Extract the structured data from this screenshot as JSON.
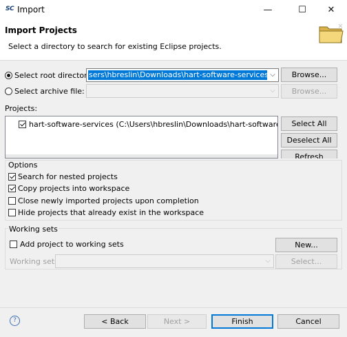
{
  "window": {
    "app_icon": "SC",
    "title": "Import",
    "controls": [
      "—",
      "☐",
      "✕"
    ]
  },
  "banner": {
    "title": "Import Projects",
    "description": "Select a directory to search for existing Eclipse projects."
  },
  "source": {
    "root_directory_label": "Select root directory:",
    "root_directory_value": "sers\\hbreslin\\Downloads\\hart-software-services-master",
    "root_selected": true,
    "archive_file_label": "Select archive file:",
    "archive_file_value": "",
    "browse_label": "Browse...",
    "browse_archive_label": "Browse..."
  },
  "projects": {
    "label": "Projects:",
    "items": [
      {
        "checked": true,
        "text": "hart-software-services (C:\\Users\\hbreslin\\Downloads\\hart-software-services-m"
      }
    ],
    "select_all_label": "Select All",
    "deselect_all_label": "Deselect All",
    "refresh_label": "Refresh"
  },
  "options": {
    "label": "Options",
    "items": [
      {
        "label": "Search for nested projects",
        "checked": true
      },
      {
        "label": "Copy projects into workspace",
        "checked": true
      },
      {
        "label": "Close newly imported projects upon completion",
        "checked": false
      },
      {
        "label": "Hide projects that already exist in the workspace",
        "checked": false
      }
    ]
  },
  "working_sets": {
    "label": "Working sets",
    "add_label": "Add project to working sets",
    "add_checked": false,
    "new_label": "New...",
    "working_sets_field_label": "Working sets",
    "working_sets_value": "",
    "select_label": "Select..."
  },
  "footer": {
    "back_label": "< Back",
    "next_label": "Next >",
    "finish_label": "Finish",
    "cancel_label": "Cancel",
    "help_icon": "?"
  }
}
